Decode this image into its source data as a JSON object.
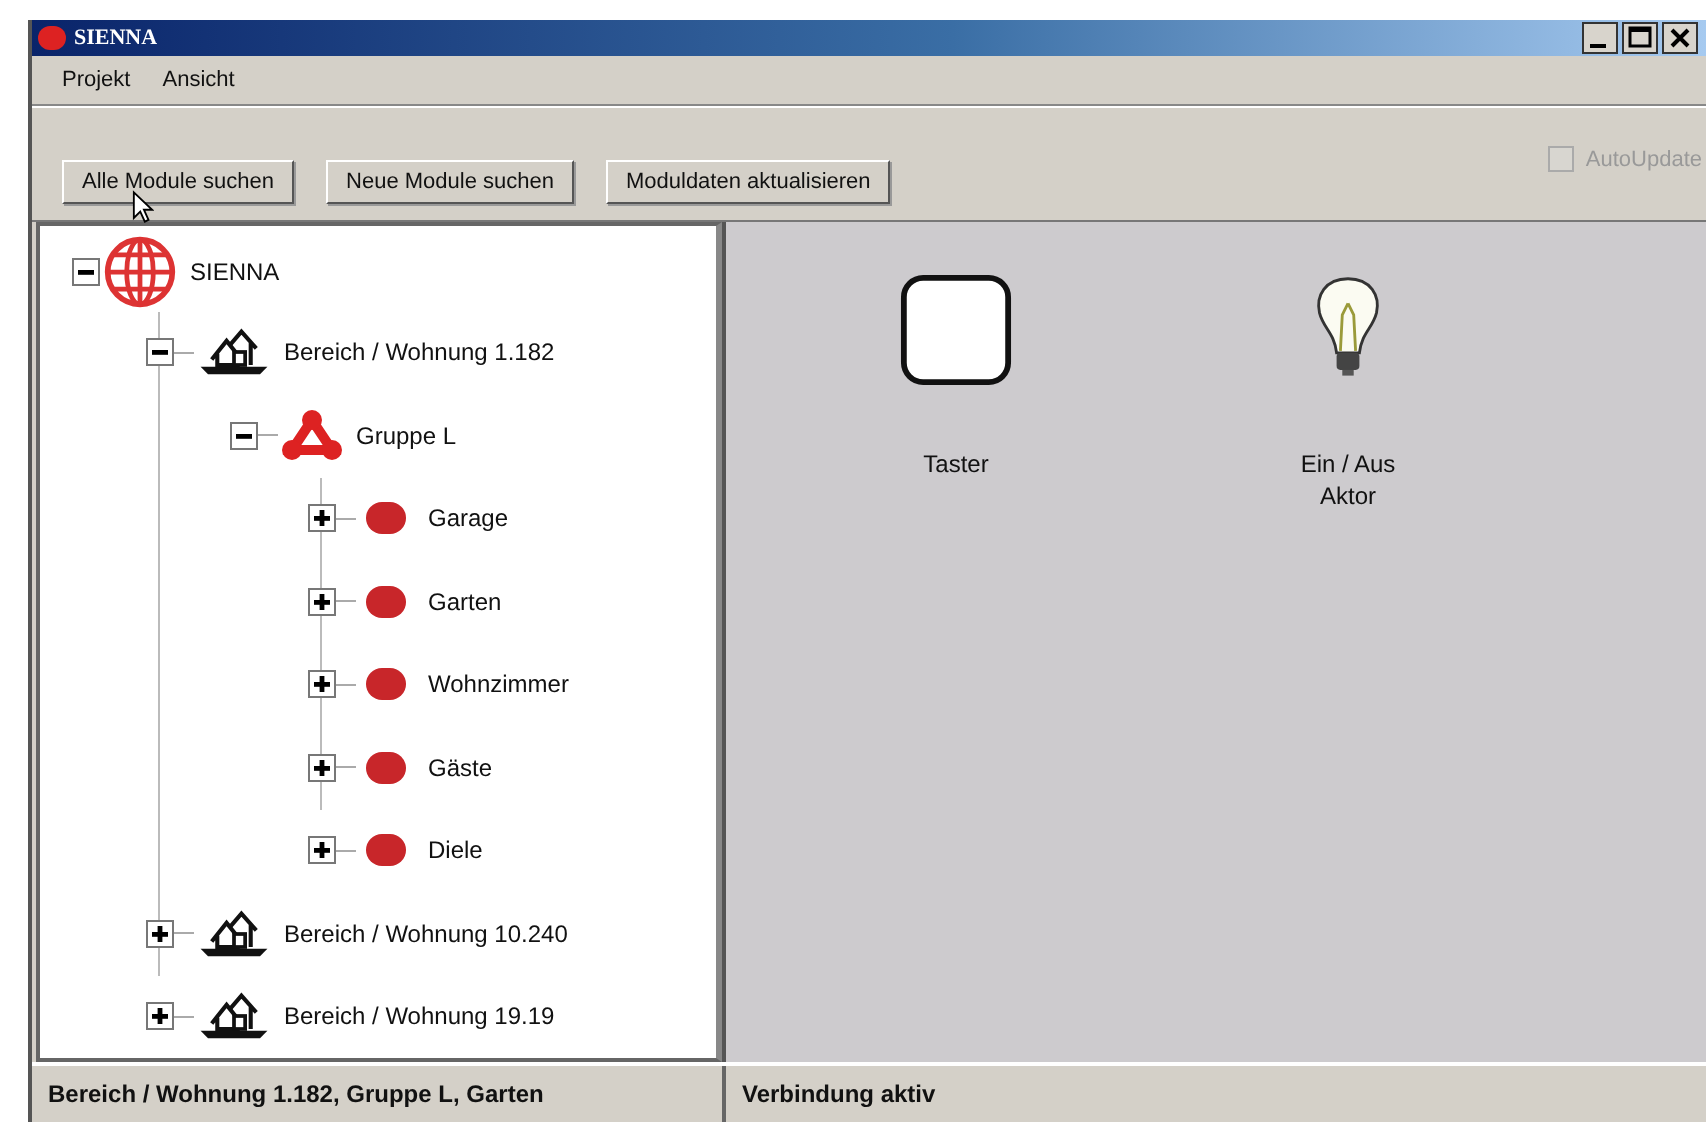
{
  "window": {
    "title": "SIENNA"
  },
  "menu": [
    "Projekt",
    "Ansicht"
  ],
  "toolbar": {
    "buttons": [
      "Alle Module suchen",
      "Neue Module suchen",
      "Moduldaten aktualisieren"
    ],
    "autoupdate": {
      "label": "AutoUpdate",
      "checked": false,
      "disabled": true
    }
  },
  "tree": [
    {
      "kind": "root",
      "label": "SIENNA",
      "expanded": true,
      "children": [
        {
          "kind": "area",
          "label": "Bereich / Wohnung 1.182",
          "expanded": true,
          "children": [
            {
              "kind": "group",
              "label": "Gruppe L",
              "expanded": true,
              "children": [
                {
                  "kind": "room",
                  "label": "Garage",
                  "expanded": false
                },
                {
                  "kind": "room",
                  "label": "Garten",
                  "expanded": false
                },
                {
                  "kind": "room",
                  "label": "Wohnzimmer",
                  "expanded": false
                },
                {
                  "kind": "room",
                  "label": "Gäste",
                  "expanded": false
                },
                {
                  "kind": "room",
                  "label": "Diele",
                  "expanded": false
                }
              ]
            }
          ]
        },
        {
          "kind": "area",
          "label": "Bereich / Wohnung 10.240",
          "expanded": false
        },
        {
          "kind": "area",
          "label": "Bereich / Wohnung 19.19",
          "expanded": false
        }
      ]
    }
  ],
  "modules": [
    {
      "kind": "button",
      "label": "Taster"
    },
    {
      "kind": "lamp",
      "label": "Ein / Aus\nAktor"
    }
  ],
  "status_bar": [
    "Bereich / Wohnung 1.182, Gruppe L, Garten",
    "Verbindung aktiv"
  ]
}
